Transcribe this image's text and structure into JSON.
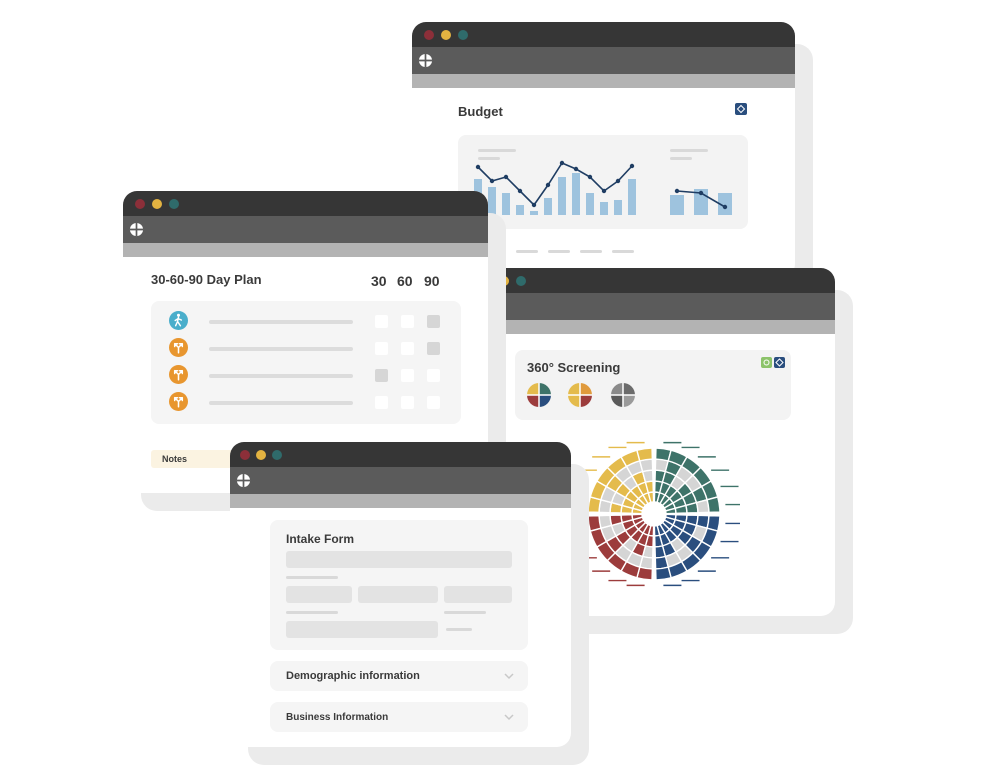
{
  "budget": {
    "title": "Budget",
    "chart": {
      "bar_color": "#9ec3de",
      "line_color": "#1f3d63"
    }
  },
  "plan": {
    "title": "30-60-90 Day Plan",
    "columns": [
      "30",
      "60",
      "90"
    ],
    "rows": [
      {
        "icon": "walking-person-icon",
        "color": "#4aaecb",
        "checks": [
          false,
          false,
          true
        ]
      },
      {
        "icon": "branch-icon",
        "color": "#e8962f",
        "checks": [
          false,
          false,
          true
        ]
      },
      {
        "icon": "branch-icon",
        "color": "#e8962f",
        "checks": [
          true,
          false,
          false
        ]
      },
      {
        "icon": "branch-icon",
        "color": "#e8962f",
        "checks": [
          false,
          false,
          false
        ]
      }
    ],
    "notes_label": "Notes"
  },
  "screening": {
    "title": "360° Screening",
    "colors": {
      "gold": "#e4bb4c",
      "green": "#3e7369",
      "red": "#9c3c3c",
      "blue": "#2a4e7e",
      "grey": "#6b6b6b"
    }
  },
  "intake": {
    "title": "Intake Form",
    "sections": [
      {
        "label": "Demographic information"
      },
      {
        "label": "Business Information"
      }
    ]
  },
  "window_dots": {
    "red": "#8c2f39",
    "yellow": "#e3b341",
    "teal": "#2f6b6b"
  },
  "accent": "#2a4e7e"
}
